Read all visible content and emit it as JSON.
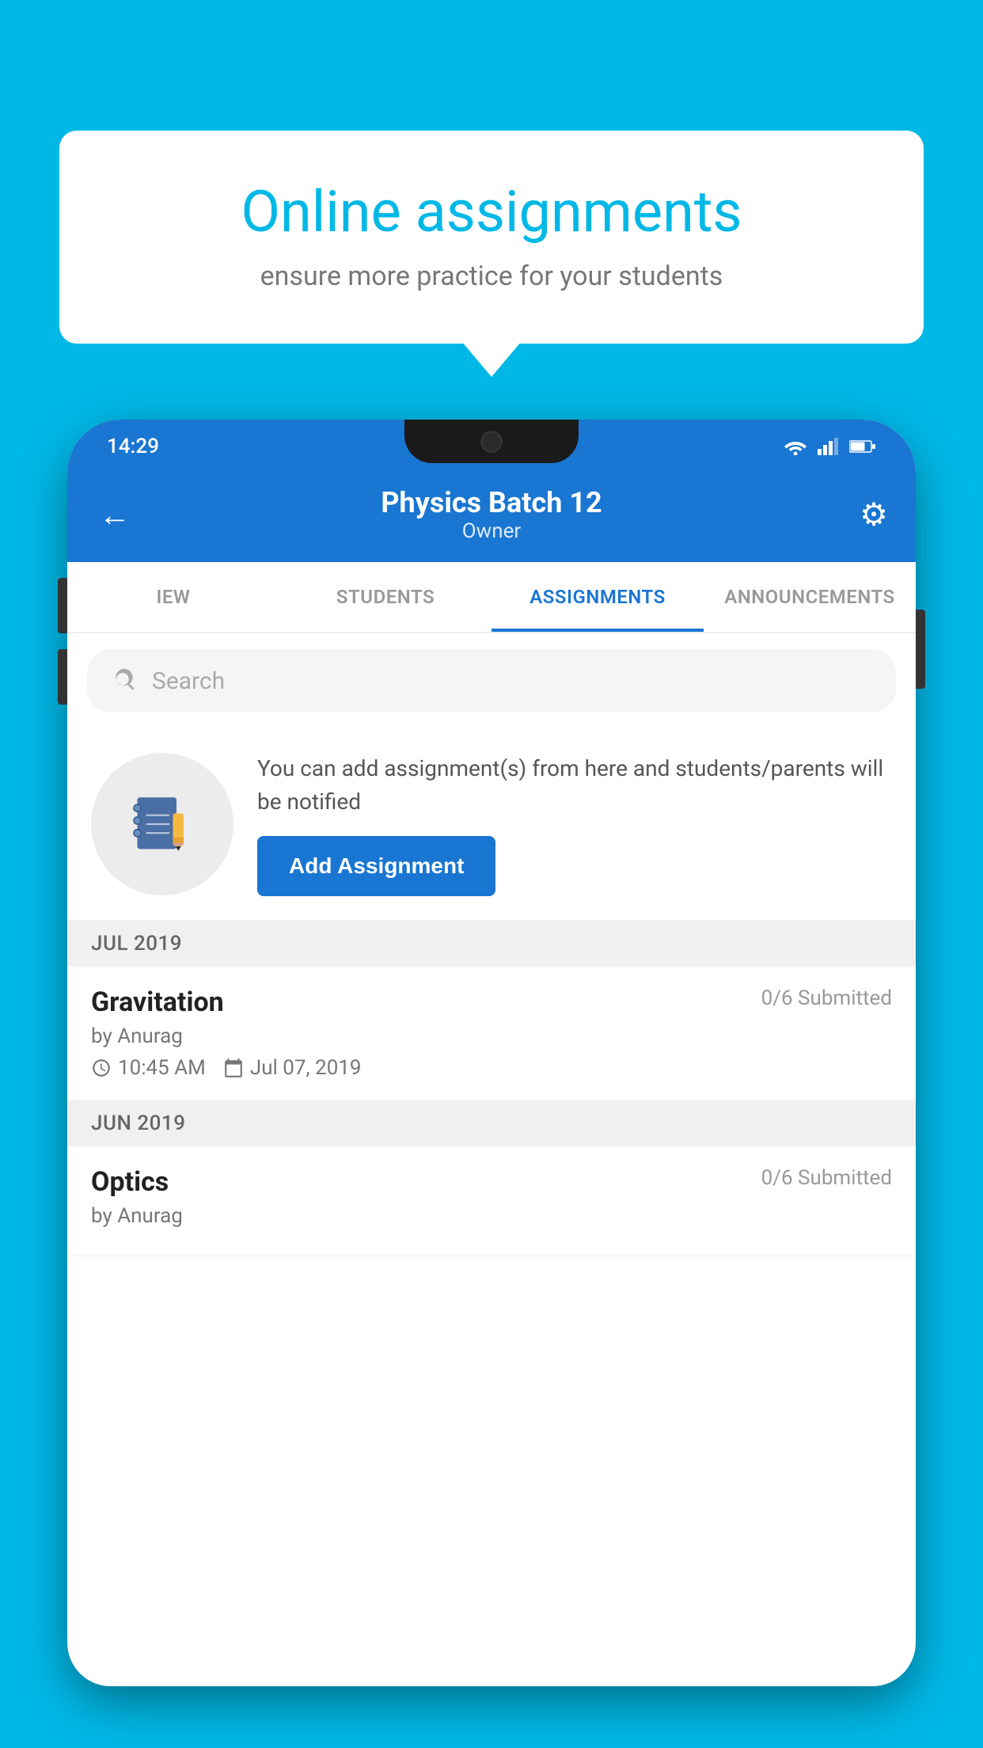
{
  "background": {
    "color": "#00b8e6"
  },
  "speech_bubble": {
    "title": "Online assignments",
    "subtitle": "ensure more practice for your students"
  },
  "status_bar": {
    "time": "14:29"
  },
  "app_bar": {
    "title": "Physics Batch 12",
    "subtitle": "Owner",
    "back_label": "←",
    "settings_label": "⚙"
  },
  "tabs": [
    {
      "id": "iew",
      "label": "IEW",
      "active": false
    },
    {
      "id": "students",
      "label": "STUDENTS",
      "active": false
    },
    {
      "id": "assignments",
      "label": "ASSIGNMENTS",
      "active": true
    },
    {
      "id": "announcements",
      "label": "ANNOUNCEMENTS",
      "active": false
    }
  ],
  "search": {
    "placeholder": "Search"
  },
  "add_assignment_section": {
    "description": "You can add assignment(s) from here and students/parents will be notified",
    "button_label": "Add Assignment"
  },
  "assignment_groups": [
    {
      "month_label": "JUL 2019",
      "assignments": [
        {
          "name": "Gravitation",
          "submitted": "0/6 Submitted",
          "author": "by Anurag",
          "time": "10:45 AM",
          "date": "Jul 07, 2019"
        }
      ]
    },
    {
      "month_label": "JUN 2019",
      "assignments": [
        {
          "name": "Optics",
          "submitted": "0/6 Submitted",
          "author": "by Anurag",
          "time": "",
          "date": ""
        }
      ]
    }
  ]
}
